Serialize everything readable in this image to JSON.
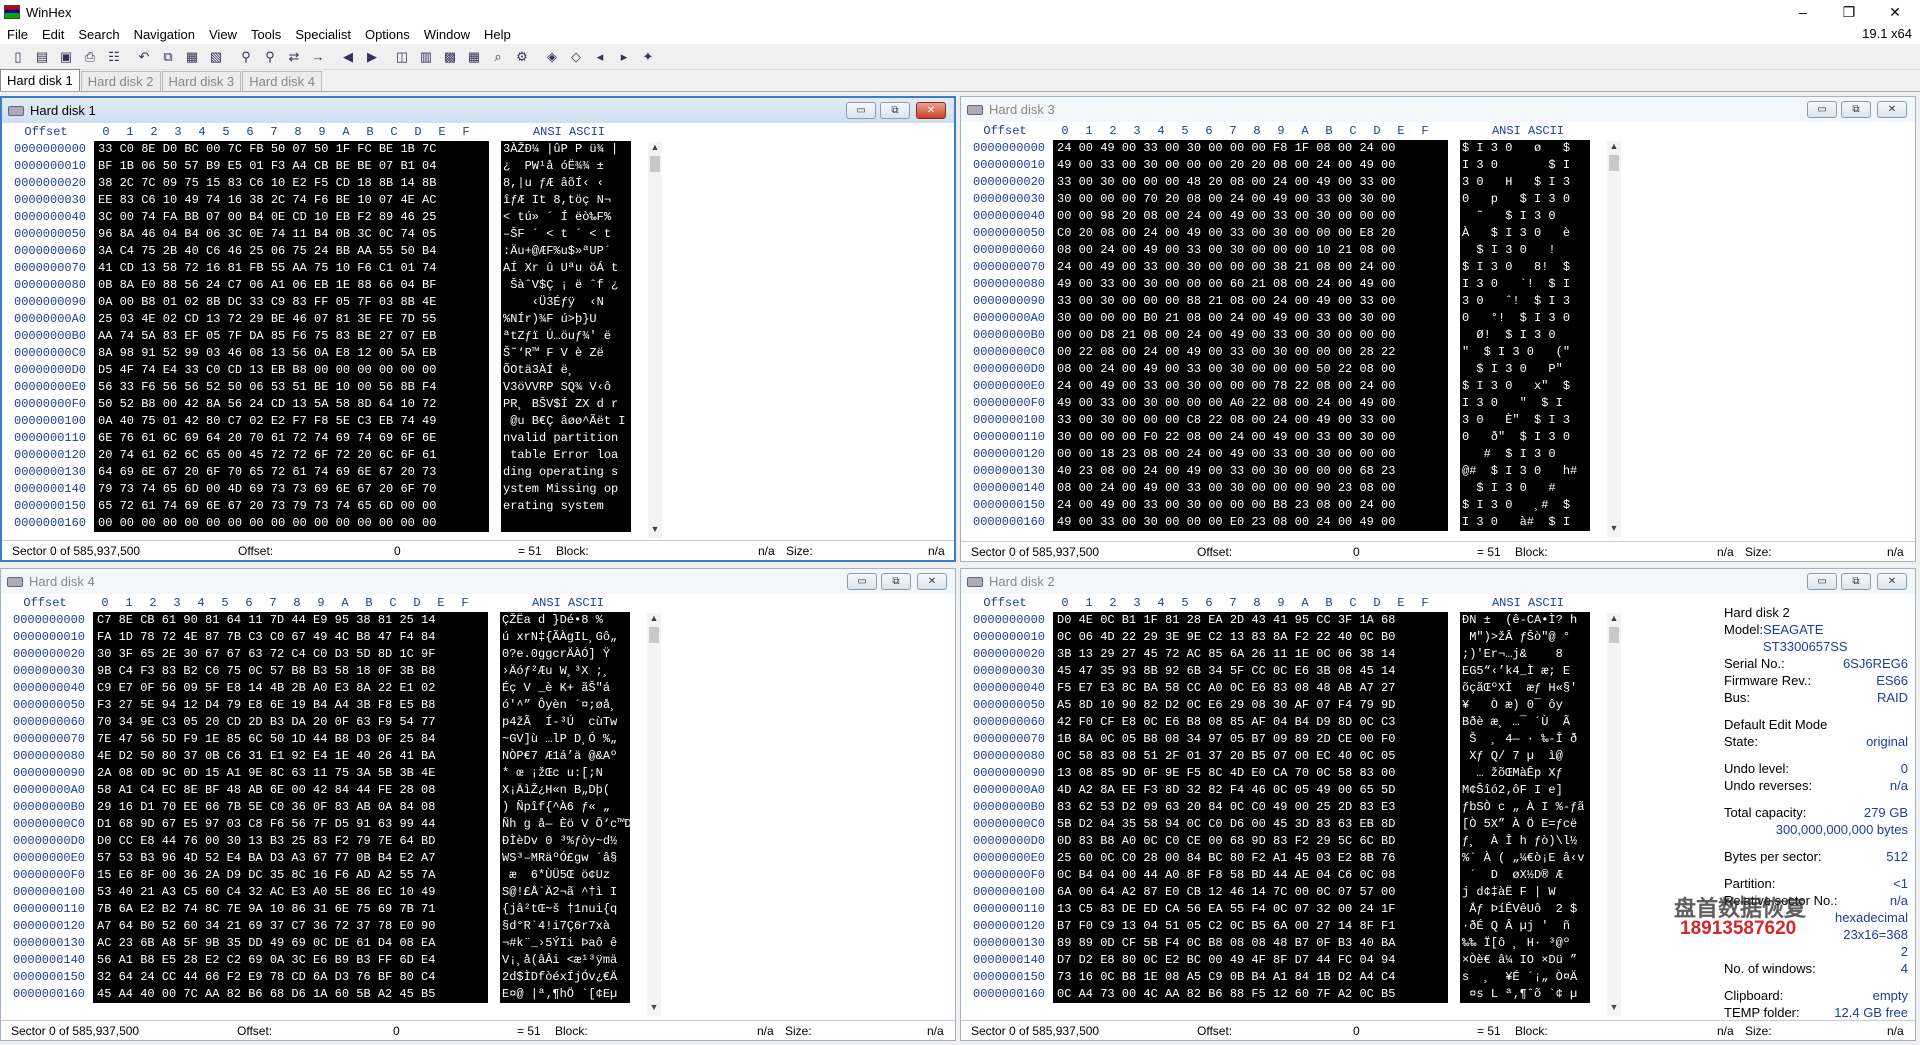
{
  "window": {
    "title": "WinHex",
    "version": "19.1 x64"
  },
  "menu": [
    "File",
    "Edit",
    "Search",
    "Navigation",
    "View",
    "Tools",
    "Specialist",
    "Options",
    "Window",
    "Help"
  ],
  "toolbar_icons": [
    "new-file-icon",
    "open-icon",
    "save-icon",
    "print-icon",
    "properties-icon",
    "undo-icon",
    "copy-icon",
    "paste-icon",
    "paste-write-icon",
    "find-text-icon",
    "find-hex-icon",
    "replace-icon",
    "goto-icon",
    "back-icon",
    "forward-icon",
    "open-disk-icon",
    "clone-icon",
    "ram-icon",
    "calculator-icon",
    "analyze-icon",
    "tools-icon",
    "pattern-icon",
    "copy-block-icon",
    "prev-page-icon",
    "next-page-icon",
    "settings-icon"
  ],
  "tabs": [
    "Hard disk 1",
    "Hard disk 2",
    "Hard disk 3",
    "Hard disk 4"
  ],
  "hex_header": {
    "offset": "Offset",
    "cols": [
      "0",
      "1",
      "2",
      "3",
      "4",
      "5",
      "6",
      "7",
      "8",
      "9",
      "A",
      "B",
      "C",
      "D",
      "E",
      "F"
    ],
    "ascii": "ANSI ASCII"
  },
  "offsets": [
    "0000000000",
    "0000000010",
    "0000000020",
    "0000000030",
    "0000000040",
    "0000000050",
    "0000000060",
    "0000000070",
    "0000000080",
    "0000000090",
    "00000000A0",
    "00000000B0",
    "00000000C0",
    "00000000D0",
    "00000000E0",
    "00000000F0",
    "0000000100",
    "0000000110",
    "0000000120",
    "0000000130",
    "0000000140",
    "0000000150",
    "0000000160"
  ],
  "windows": [
    {
      "title": "Hard disk 1",
      "hex": [
        "33 C0 8E D0 BC 00 7C FB 50 07 50 1F FC BE 1B 7C",
        "BF 1B 06 50 57 B9 E5 01 F3 A4 CB BE BE 07 B1 04",
        "38 2C 7C 09 75 15 83 C6 10 E2 F5 CD 18 8B 14 8B",
        "EE 83 C6 10 49 74 16 38 2C 74 F6 BE 10 07 4E AC",
        "3C 00 74 FA BB 07 00 B4 0E CD 10 EB F2 89 46 25",
        "96 8A 46 04 B4 06 3C 0E 74 11 B4 0B 3C 0C 74 05",
        "3A C4 75 2B 40 C6 46 25 06 75 24 BB AA 55 50 B4",
        "41 CD 13 58 72 16 81 FB 55 AA 75 10 F6 C1 01 74",
        "0B 8A E0 88 56 24 C7 06 A1 06 EB 1E 88 66 04 BF",
        "0A 00 B8 01 02 8B DC 33 C9 83 FF 05 7F 03 8B 4E",
        "25 03 4E 02 CD 13 72 29 BE 46 07 81 3E FE 7D 55",
        "AA 74 5A 83 EF 05 7F DA 85 F6 75 83 BE 27 07 EB",
        "8A 98 91 52 99 03 46 08 13 56 0A E8 12 00 5A EB",
        "D5 4F 74 E4 33 C0 CD 13 EB B8 00 00 00 00 00 00",
        "56 33 F6 56 56 52 50 06 53 51 BE 10 00 56 8B F4",
        "50 52 B8 00 42 8A 56 24 CD 13 5A 58 8D 64 10 72",
        "0A 40 75 01 42 80 C7 02 E2 F7 F8 5E C3 EB 74 49",
        "6E 76 61 6C 69 64 20 70 61 72 74 69 74 69 6F 6E",
        "20 74 61 62 6C 65 00 45 72 72 6F 72 20 6C 6F 61",
        "64 69 6E 67 20 6F 70 65 72 61 74 69 6E 67 20 73",
        "79 73 74 65 6D 00 4D 69 73 73 69 6E 67 20 6F 70",
        "65 72 61 74 69 6E 67 20 73 79 73 74 65 6D 00 00",
        "00 00 00 00 00 00 00 00 00 00 00 00 00 00 00 00"
      ],
      "ascii": [
        "3ÀŽÐ¼ |ûP P ü¾ |",
        "¿  PW¹å óË¾¾ ± ",
        "8,|u ƒÆ âõÍ‹ ‹",
        "îƒÆ It 8,töç N¬",
        "< tú» ´ Í ëò‰F%",
        "–ŠF ´ < t ´ < t ",
        ":Äu+@ÆF%u$»ªUP´",
        "AÍ Xr û Uªu öÁ t",
        " ŠàˆV$Ç ¡ ë ˆf ¿",
        "    ‹Ü3Éƒÿ  ‹N",
        "%NÍr)¾F ú>þ}U",
        "ªtZƒï Ú…öuƒ¾' ë",
        "Š˜‘R™ F V è Zë",
        "ÕOtä3ÀÍ ë¸      ",
        "V3öVVRP SQ¾ V‹ô",
        "PR¸ BŠV$Í ZX d r",
        " @u B€Ç âøø^Ãët I",
        "nvalid partition",
        " table Error loa",
        "ding operating s",
        "ystem Missing op",
        "erating system  ",
        "                "
      ],
      "status": {
        "sector": "Sector 0 of 585,937,500",
        "offset_label": "Offset:",
        "offset_val": "0",
        "eq": "= 51",
        "block_label": "Block:",
        "block_val": "n/a",
        "size_label": "Size:",
        "size_val": "n/a"
      }
    },
    {
      "title": "Hard disk 3",
      "hex": [
        "24 00 49 00 33 00 30 00 00 00 F8 1F 08 00 24 00",
        "49 00 33 00 30 00 00 00 20 20 08 00 24 00 49 00",
        "33 00 30 00 00 00 48 20 08 00 24 00 49 00 33 00",
        "30 00 00 00 70 20 08 00 24 00 49 00 33 00 30 00",
        "00 00 98 20 08 00 24 00 49 00 33 00 30 00 00 00",
        "C0 20 08 00 24 00 49 00 33 00 30 00 00 00 E8 20",
        "08 00 24 00 49 00 33 00 30 00 00 00 10 21 08 00",
        "24 00 49 00 33 00 30 00 00 00 38 21 08 00 24 00",
        "49 00 33 00 30 00 00 00 60 21 08 00 24 00 49 00",
        "33 00 30 00 00 00 88 21 08 00 24 00 49 00 33 00",
        "30 00 00 00 B0 21 08 00 24 00 49 00 33 00 30 00",
        "00 00 D8 21 08 00 24 00 49 00 33 00 30 00 00 00",
        "00 22 08 00 24 00 49 00 33 00 30 00 00 00 28 22",
        "08 00 24 00 49 00 33 00 30 00 00 00 50 22 08 00",
        "24 00 49 00 33 00 30 00 00 00 78 22 08 00 24 00",
        "49 00 33 00 30 00 00 00 A0 22 08 00 24 00 49 00",
        "33 00 30 00 00 00 C8 22 08 00 24 00 49 00 33 00",
        "30 00 00 00 F0 22 08 00 24 00 49 00 33 00 30 00",
        "00 00 18 23 08 00 24 00 49 00 33 00 30 00 00 00",
        "40 23 08 00 24 00 49 00 33 00 30 00 00 00 68 23",
        "08 00 24 00 49 00 33 00 30 00 00 00 90 23 08 00",
        "24 00 49 00 33 00 30 00 00 00 B8 23 08 00 24 00",
        "49 00 33 00 30 00 00 00 E0 23 08 00 24 00 49 00"
      ],
      "ascii": [
        "$ I 3 0   ø   $ ",
        "I 3 0       $ I ",
        "3 0   H   $ I 3 ",
        "0   p   $ I 3 0 ",
        "  ˜   $ I 3 0   ",
        "À   $ I 3 0   è ",
        "  $ I 3 0   !   ",
        "$ I 3 0   8!  $ ",
        "I 3 0   `!  $ I ",
        "3 0   ˆ!  $ I 3 ",
        "0   °!  $ I 3 0 ",
        "  Ø!  $ I 3 0   ",
        "\"  $ I 3 0   (\"",
        "  $ I 3 0   P\"  ",
        "$ I 3 0   x\"  $ ",
        "I 3 0   \"  $ I ",
        "3 0   È\"  $ I 3 ",
        "0   ð\"  $ I 3 0 ",
        "   #  $ I 3 0   ",
        "@#  $ I 3 0   h#",
        "  $ I 3 0   #   ",
        "$ I 3 0   ¸#  $ ",
        "I 3 0   à#  $ I "
      ],
      "status": {
        "sector": "Sector 0 of 585,937,500",
        "offset_label": "Offset:",
        "offset_val": "0",
        "eq": "= 51",
        "block_label": "Block:",
        "block_val": "n/a",
        "size_label": "Size:",
        "size_val": "n/a"
      }
    },
    {
      "title": "Hard disk 4",
      "hex": [
        "C7 8E CB 61 90 81 64 11 7D 44 E9 95 38 81 25 14",
        "FA 1D 78 72 4E 87 7B C3 C0 67 49 4C B8 47 F4 84",
        "30 3F 65 2E 30 67 67 63 72 C4 C0 D3 5D 8D 1C 9F",
        "9B C4 F3 83 B2 C6 75 0C 57 B8 B3 58 18 0F 3B B8",
        "C9 E7 0F 56 09 5F E8 14 4B 2B A0 E3 8A 22 E1 02",
        "F3 27 5E 94 12 D4 79 E8 6E 19 B4 A4 3B F8 E5 B8",
        "70 34 9E C3 05 20 CD 2D B3 DA 20 0F 63 F9 54 77",
        "7E 47 56 5D F9 1E 85 6C 50 1D 44 B8 D3 0F 25 84",
        "4E D2 50 80 37 0B C6 31 E1 92 E4 1E 40 26 41 BA",
        "2A 08 0D 9C 0D 15 A1 9E 8C 63 11 75 3A 5B 3B 4E",
        "58 A1 C4 EC 8E BF 48 AB 6E 00 42 84 44 FE 28 08",
        "29 16 D1 70 EE 66 7B 5E C0 36 0F 83 AB 0A 84 08",
        "D1 68 9D 67 E5 97 03 C8 F6 56 7F D5 91 63 99 44",
        "D0 CC E8 44 76 00 30 13 B3 25 83 F2 79 7E 64 BD",
        "57 53 B3 96 4D 52 E4 BA D3 A3 67 77 0B B4 E2 A7",
        "15 E6 8F 00 36 2A D9 DC 35 8C 16 F6 AD A2 55 7A",
        "53 40 21 A3 C5 60 C4 32 AC E3 A0 5E 86 EC 10 49",
        "7B 6A E2 B2 74 8C 7E 9A 10 86 31 6E 75 69 7B 71",
        "A7 64 B0 52 60 34 21 69 37 C7 36 72 37 78 E0 90",
        "AC 23 6B A8 5F 9B 35 DD 49 69 0C DE 61 D4 08 EA",
        "56 A1 B8 E5 28 E2 C2 69 0A 3C E6 B9 B3 FF 6D E4",
        "32 64 24 CC 44 66 F2 E9 78 CD 6A D3 76 BF 80 C4",
        "45 A4 40 00 7C AA 82 B6 68 D6 1A 60 5B A2 45 B5"
      ],
      "ascii": [
        "ÇŽËa d }Dé•8 %",
        "ú xrN‡{ÃÀgIL¸Gô„",
        "0?e.0ggcrÄÀÓ] Ÿ",
        "›Äóƒ²Æu W¸³X ;¸",
        "Éç V _è K+ ãŠ\"á ",
        "ó'^” Ôyèn ´¤;øå¸",
        "p4žÃ  Í-³Ú  cùTw",
        "~GV]ù …lP D¸Ó %„",
        "NÒP€7 Æ1á’ä @&Aº",
        "* œ ¡žŒc u:[;N",
        "X¡ÄìŽ¿H«n B„Dþ(",
        ") Ñpîf{^À6 ƒ« „",
        "Ñh g å— Èö V Õ‘c™D",
        "ÐÌèDv 0 ³%ƒòy~d½",
        "WS³–MRäºÓ£gw ´â§",
        " æ  6*ÙÜ5Œ ö­¢Uz",
        "S@!£Å`Ä2¬ã ^†ì I",
        "{jâ²tŒ~š †1nui{q",
        "§d°R`4!i7Ç6r7xà ",
        "¬#k¨_›5ÝIi Þaô ê",
        "V¡¸å(âÂi <æ¹³ÿmä",
        "2d$ÌDfòéxÍjÓv¿€Ä",
        "E¤@ |ª‚¶hÖ `[¢Eµ"
      ],
      "status": {
        "sector": "Sector 0 of 585,937,500",
        "offset_label": "Offset:",
        "offset_val": "0",
        "eq": "= 51",
        "block_label": "Block:",
        "block_val": "n/a",
        "size_label": "Size:",
        "size_val": "n/a"
      }
    },
    {
      "title": "Hard disk 2",
      "hex": [
        "D0 4E 0C B1 1F 81 28 EA 2D 43 41 95 CC 3F 1A 68",
        "0C 06 4D 22 29 3E 9E C2 13 83 8A F2 22 40 0C B0",
        "3B 13 29 27 45 72 AC 85 6A 26 11 1E 0C 06 38 14",
        "45 47 35 93 8B 92 6B 34 5F CC 0C E6 3B 08 45 14",
        "F5 E7 E3 8C BA 58 CC A0 0C E6 83 08 48 AB A7 27",
        "A5 8D 10 90 82 D2 0C E6 29 08 30 AF 07 F4 79 9D",
        "42 F0 CF E8 0C E6 B8 08 85 AF 04 B4 D9 8D 0C C3",
        "1B 8A 0C 05 B8 08 34 97 05 B7 09 89 2D CE 00 F0",
        "0C 58 83 08 51 2F 01 37 20 B5 07 00 EC 40 0C 05",
        "13 08 85 9D 0F 9E F5 8C 4D E0 CA 70 0C 58 83 00",
        "4D A2 8A EE F3 8D 32 82 F4 46 0C 05 49 00 65 5D",
        "83 62 53 D2 09 63 20 84 0C C0 49 00 25 2D 83 E3",
        "5B D2 04 35 58 94 0C C0 D6 00 45 3D 83 63 EB 8D",
        "0D 83 B8 A0 0C C0 CE 00 68 9D 83 F2 29 5C 6C BD",
        "25 60 0C C0 28 00 84 BC 80 F2 A1 45 03 E2 8B 76",
        "0C B4 04 00 44 A0 8F F8 58 BD 44 AE 04 C6 0C 08",
        "6A 00 64 A2 87 E0 CB 12 46 14 7C 00 0C 07 57 00",
        "13 C5 83 DE ED CA 56 EA 55 F4 0C 07 32 00 24 1F",
        "B7 F0 C9 13 04 51 05 C2 0C B5 6A 00 27 14 8F F1",
        "89 89 0D CF 5B F4 0C B8 08 08 48 B7 0F B3 40 BA",
        "D7 D2 E8 80 0C E2 BC 00 49 4F 8F D7 44 FC 04 94",
        "73 16 0C B8 1E 08 A5 C9 0B B4 A1 84 1B D2 A4 C4",
        "0C A4 73 00 4C AA 82 B6 88 F5 12 60 7F A2 0C B5"
      ],
      "ascii": [
        "ÐN ±  (ê-CA•Ì? h",
        " M\")>žÂ ƒŠò\"@ °",
        ";)'Er¬…j&    8 ",
        "EG5“‹’k4_Ì æ; E ",
        "õçãŒºXÌ  æƒ H«§'",
        "¥   Ò æ) 0¯ ôy ",
        "Bðè æ¸ …¯ ´Ù  Ã",
        " Š  ¸ 4— · ‰-Î ð",
        " Xƒ Q/ 7 µ  ì@  ",
        "  … žõŒMàÊp Xƒ ",
        "M¢Šîó2‚ôF I e]",
        "ƒbSÒ c „ À I %-ƒã",
        "[Ò 5X” À Ö E=ƒcë",
        "ƒ¸  À Î h ƒò)\\l½",
        "%` À ( „¼€ò¡E â‹v",
        " ´  D  øX½D® Æ  ",
        "j d¢‡àË F | W ",
        " Åƒ ÞíÊVêUô  2 $ ",
        "·ðÉ Q Â µj '  ñ",
        "‰‰ Ï[ô ¸ H· ³@º",
        "×Òè€ â¼ IO ×Dü ”",
        "s  ¸  ¥É ´¡„ Ò¤Ä",
        " ¤s L ª‚¶ˆõ `¢ µ"
      ],
      "status": {
        "sector": "Sector 0 of 585,937,500",
        "offset_label": "Offset:",
        "offset_val": "0",
        "eq": "= 51",
        "block_label": "Block:",
        "block_val": "n/a",
        "size_label": "Size:",
        "size_val": "n/a"
      }
    }
  ],
  "info_panel": {
    "title": "Hard disk 2",
    "model_label": "Model:",
    "model": "SEAGATE ST3300657SS",
    "serial_label": "Serial No.:",
    "serial": "6SJ6REG6",
    "fw_label": "Firmware Rev.:",
    "fw": "ES66",
    "bus_label": "Bus:",
    "bus": "RAID",
    "mode_title": "Default Edit Mode",
    "state_label": "State:",
    "state": "original",
    "undo_label": "Undo level:",
    "undo": "0",
    "undo_rev_label": "Undo reverses:",
    "undo_rev": "n/a",
    "cap_label": "Total capacity:",
    "cap1": "279 GB",
    "cap2": "300,000,000,000 bytes",
    "bps_label": "Bytes per sector:",
    "bps": "512",
    "part_label": "Partition:",
    "part": "<1",
    "rel_label": "Relative sector No.:",
    "rel": "n/a",
    "mode_val": "hexadecimal",
    "grid_val": "23x16=368",
    "pages_val": "2",
    "windows_label": "No. of windows:",
    "windows_val": "4",
    "clip_label": "Clipboard:",
    "clip": "empty",
    "temp_label": "TEMP folder:",
    "temp": "12.4 GB free"
  },
  "watermark": {
    "text": "盘首数据恢复",
    "phone": "18913587620"
  }
}
